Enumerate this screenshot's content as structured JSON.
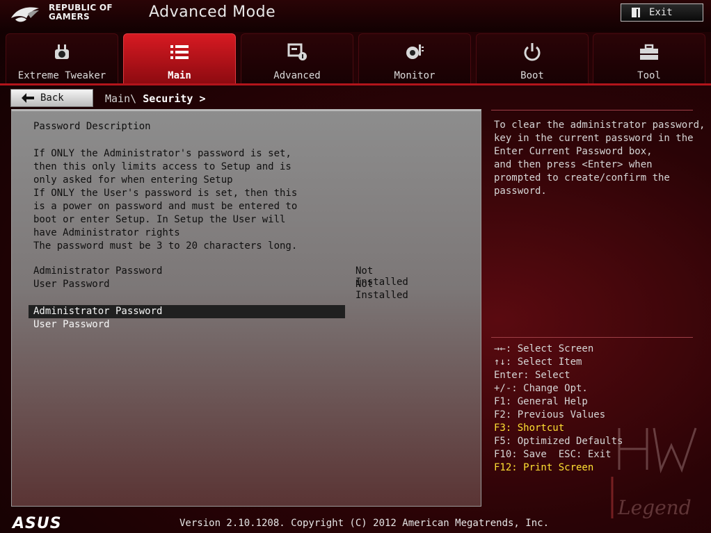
{
  "header": {
    "brand_line1": "REPUBLIC OF",
    "brand_line2": "GAMERS",
    "mode_title": "Advanced Mode",
    "exit_label": "Exit"
  },
  "tabs": [
    {
      "label": "Extreme Tweaker",
      "icon": "tweaker-icon",
      "active": false
    },
    {
      "label": "Main",
      "icon": "list-icon",
      "active": true
    },
    {
      "label": "Advanced",
      "icon": "advanced-icon",
      "active": false
    },
    {
      "label": "Monitor",
      "icon": "monitor-icon",
      "active": false
    },
    {
      "label": "Boot",
      "icon": "power-icon",
      "active": false
    },
    {
      "label": "Tool",
      "icon": "tool-icon",
      "active": false
    }
  ],
  "breadcrumb": {
    "back_label": "Back",
    "parent": "Main\\",
    "current": "Security",
    "arrow": ">"
  },
  "main": {
    "desc_title": "Password Description",
    "desc_lines": [
      "If ONLY the Administrator's password is set,",
      "then this only limits access to Setup and is",
      "only asked for when entering Setup",
      "If ONLY the User's password is set, then this",
      "is a power on password and must be entered to",
      "boot or enter Setup. In Setup the User will",
      "have Administrator rights",
      "The password must be 3 to 20 characters long."
    ],
    "status_rows": [
      {
        "label": "Administrator Password",
        "value": "Not Installed"
      },
      {
        "label": "User Password",
        "value": "Not Installed"
      }
    ],
    "options": [
      {
        "label": "Administrator Password",
        "selected": true
      },
      {
        "label": "User Password",
        "selected": false
      }
    ]
  },
  "help": {
    "lines": [
      "To clear the administrator password,",
      "key in the current password in the",
      "Enter Current Password box,",
      "and then press <Enter> when",
      "prompted to create/confirm the",
      "password."
    ]
  },
  "keys": [
    {
      "text": "→←: Select Screen",
      "highlight": false
    },
    {
      "text": "↑↓: Select Item",
      "highlight": false
    },
    {
      "text": "Enter: Select",
      "highlight": false
    },
    {
      "text": "+/-: Change Opt.",
      "highlight": false
    },
    {
      "text": "F1: General Help",
      "highlight": false
    },
    {
      "text": "F2: Previous Values",
      "highlight": false
    },
    {
      "text": "F3: Shortcut",
      "highlight": true
    },
    {
      "text": "F5: Optimized Defaults",
      "highlight": false
    },
    {
      "text": "F10: Save  ESC: Exit",
      "highlight": false
    },
    {
      "text": "F12: Print Screen",
      "highlight": true
    }
  ],
  "footer": {
    "logo": "ASUS",
    "version": "Version 2.10.1208. Copyright (C) 2012 American Megatrends, Inc."
  },
  "watermark": "Legend",
  "colors": {
    "accent_red": "#d71a22",
    "highlight_yellow": "#ffe033",
    "selected_row": "#202020"
  }
}
